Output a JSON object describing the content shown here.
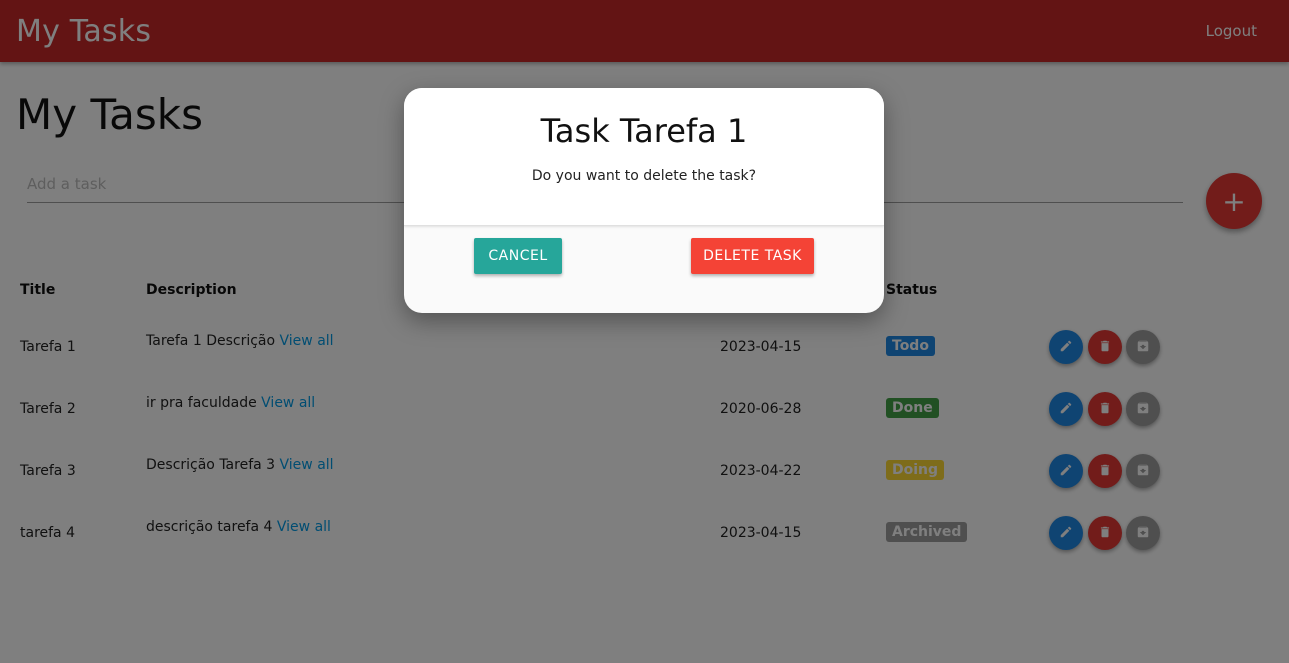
{
  "navbar": {
    "brand": "My Tasks",
    "logout": "Logout"
  },
  "page": {
    "title": "My Tasks"
  },
  "input": {
    "placeholder": "Add a task"
  },
  "fab": {
    "label": "+"
  },
  "table": {
    "headers": [
      "Title",
      "Description",
      "Status"
    ],
    "rows": [
      {
        "title": "Tarefa 1",
        "description": "Tarefa 1 Descrição",
        "link": "View all",
        "date": "2023-04-15",
        "status": "Todo",
        "status_color": "#1e88e5"
      },
      {
        "title": "Tarefa 2",
        "description": "ir pra faculdade",
        "link": "View all",
        "date": "2020-06-28",
        "status": "Done",
        "status_color": "#43a047"
      },
      {
        "title": "Tarefa 3",
        "description": "Descrição Tarefa 3",
        "link": "View all",
        "date": "2023-04-22",
        "status": "Doing",
        "status_color": "#fdd835"
      },
      {
        "title": "tarefa 4",
        "description": "descrição tarefa 4",
        "link": "View all",
        "date": "2023-04-15",
        "status": "Archived",
        "status_color": "#9e9e9e"
      }
    ]
  },
  "modal": {
    "title": "Task Tarefa 1",
    "text": "Do you want to delete the task?",
    "cancel": "CANCEL",
    "delete": "DELETE TASK"
  },
  "icons": {
    "edit": "pencil-icon",
    "delete": "trash-icon",
    "archive": "archive-icon",
    "add": "plus-icon"
  }
}
